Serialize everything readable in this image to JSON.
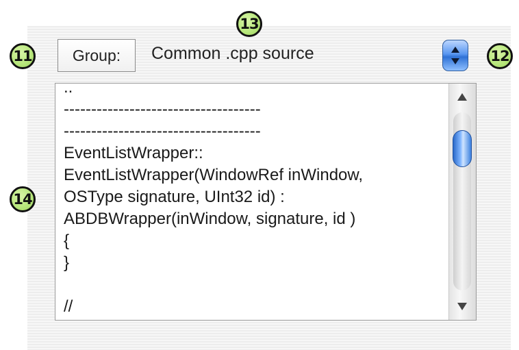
{
  "callouts": {
    "c11": "11",
    "c12": "12",
    "c13": "13",
    "c14": "14"
  },
  "toolbar": {
    "group_label": "Group:",
    "group_value": "Common .cpp source"
  },
  "editor": {
    "text": "..\n------------------------------------\n------------------------------------\nEventListWrapper::\nEventListWrapper(WindowRef inWindow,\nOSType signature, UInt32 id) :\nABDBWrapper(inWindow, signature, id )\n{\n}\n\n//"
  },
  "colors": {
    "callout_fill": "#b6e67a",
    "stepper_blue": "#2f72d6",
    "thumb_blue": "#3d82e0"
  },
  "icons": {
    "stepper": "up-down-stepper-icon",
    "scroll_up": "scroll-up-arrow-icon",
    "scroll_down": "scroll-down-arrow-icon"
  }
}
